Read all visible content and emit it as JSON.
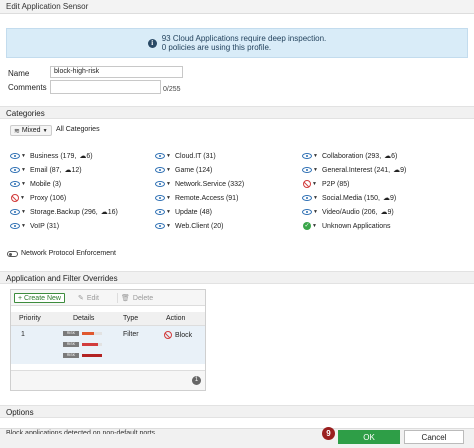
{
  "window": {
    "title": "Edit Application Sensor"
  },
  "info": {
    "line1": "93 Cloud Applications require deep inspection.",
    "line2": "0 policies are using this profile."
  },
  "form": {
    "name_label": "Name",
    "name_value": "block-high-risk",
    "comments_label": "Comments",
    "comments_value": "",
    "comments_counter": "0/255"
  },
  "categories_section": {
    "title": "Categories",
    "mixed_label": "Mixed",
    "all_categories": "All Categories",
    "items": [
      {
        "label": "Business (179,",
        "cloud": "6)",
        "action": "monitor"
      },
      {
        "label": "Email (87,",
        "cloud": "12)",
        "action": "monitor"
      },
      {
        "label": "Mobile (3)",
        "action": "monitor"
      },
      {
        "label": "Proxy (106)",
        "action": "block"
      },
      {
        "label": "Storage.Backup (296,",
        "cloud": "16)",
        "action": "monitor"
      },
      {
        "label": "VoIP (31)",
        "action": "monitor"
      },
      {
        "label": "Cloud.IT (31)",
        "action": "monitor"
      },
      {
        "label": "Game (124)",
        "action": "monitor"
      },
      {
        "label": "Network.Service (332)",
        "action": "monitor"
      },
      {
        "label": "Remote.Access (91)",
        "action": "monitor"
      },
      {
        "label": "Update (48)",
        "action": "monitor"
      },
      {
        "label": "Web.Client (20)",
        "action": "monitor"
      },
      {
        "label": "Collaboration (293,",
        "cloud": "6)",
        "action": "monitor"
      },
      {
        "label": "General.Interest (241,",
        "cloud": "9)",
        "action": "monitor"
      },
      {
        "label": "P2P (85)",
        "action": "block"
      },
      {
        "label": "Social.Media (150,",
        "cloud": "9)",
        "action": "monitor"
      },
      {
        "label": "Video/Audio (206,",
        "cloud": "9)",
        "action": "monitor"
      },
      {
        "label": "Unknown Applications",
        "action": "allow"
      }
    ]
  },
  "network_protocol": {
    "label": "Network Protocol Enforcement",
    "enabled": false
  },
  "overrides": {
    "title": "Application and Filter Overrides",
    "create_label": "+ Create New",
    "edit_label": "Edit",
    "delete_label": "Delete",
    "columns": [
      "Priority",
      "Details",
      "Type",
      "Action"
    ],
    "rows": [
      {
        "priority": "1",
        "type": "Filter",
        "action": "Block",
        "risk_tag": "RISK",
        "risk_levels": [
          3,
          4,
          5
        ]
      }
    ],
    "count": "1"
  },
  "options": {
    "title": "Options",
    "cutoff_text": "Block applications detected on non-default ports"
  },
  "footer": {
    "step_badge": "9",
    "ok_label": "OK",
    "cancel_label": "Cancel"
  },
  "colors": {
    "ok_green": "#2e9e47",
    "block_red": "#d23c3c",
    "monitor_blue": "#2d6fb3",
    "allow_green": "#3aa64a",
    "badge_red": "#9a1f1f"
  }
}
